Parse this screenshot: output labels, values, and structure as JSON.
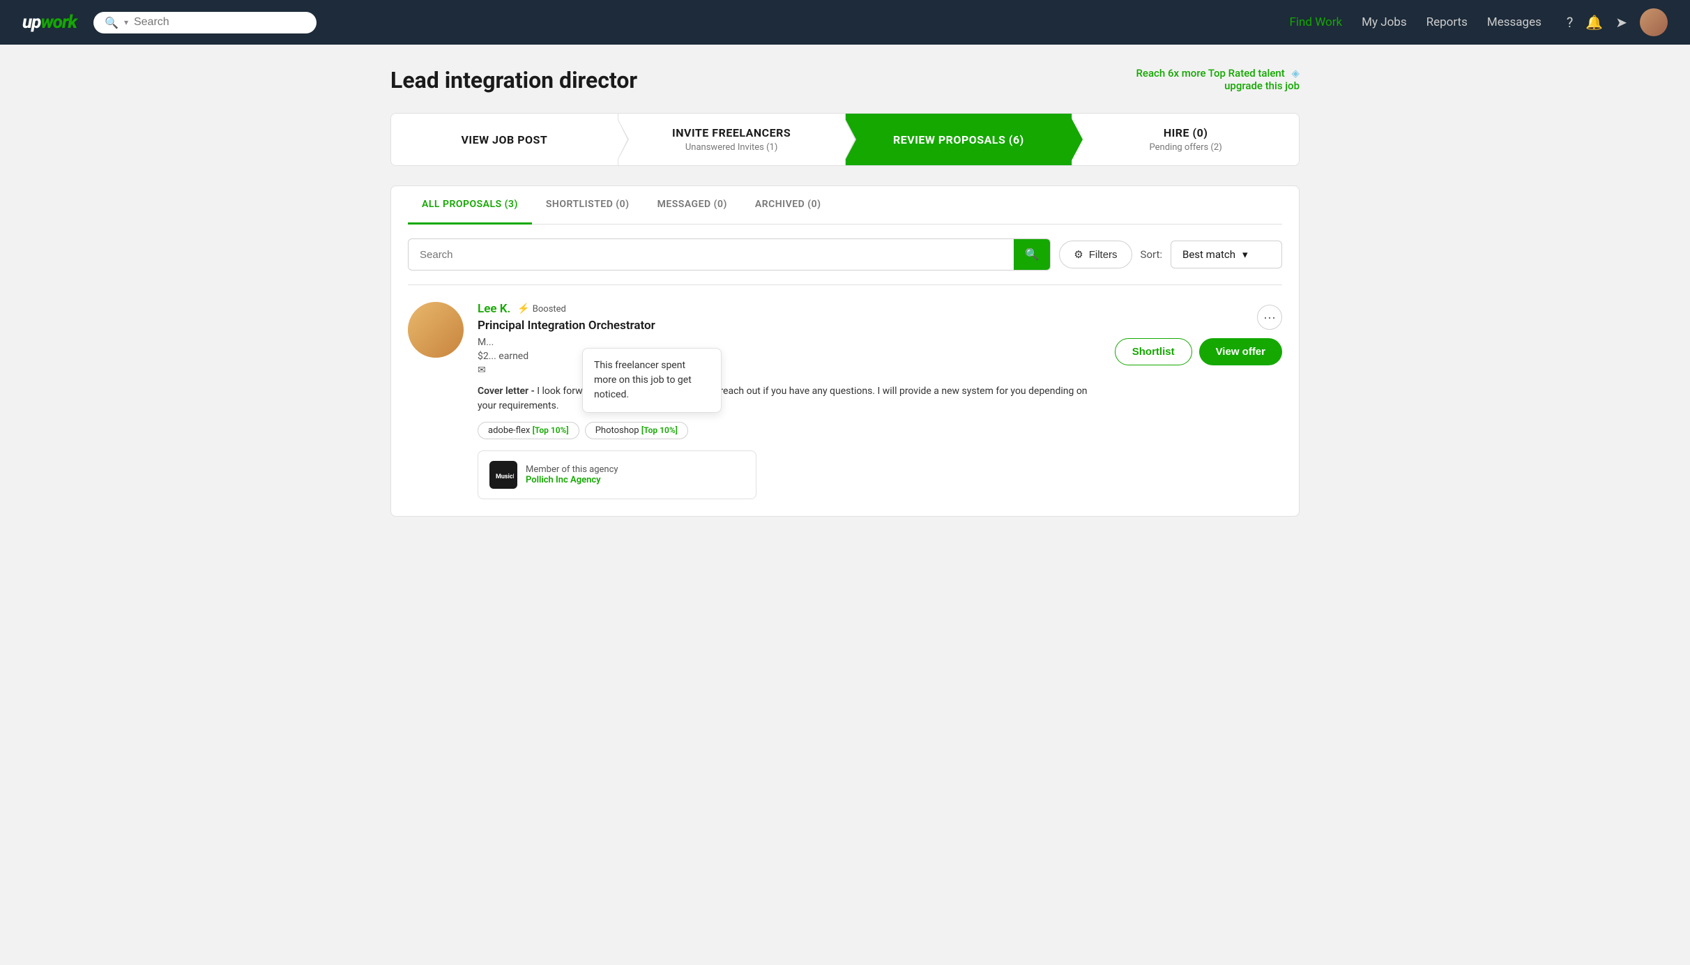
{
  "header": {
    "logo_text": "upwork",
    "search_placeholder": "Search",
    "nav": [
      {
        "id": "find-work",
        "label": "Find Work",
        "active": true
      },
      {
        "id": "my-jobs",
        "label": "My Jobs",
        "active": false
      },
      {
        "id": "reports",
        "label": "Reports",
        "active": false
      },
      {
        "id": "messages",
        "label": "Messages",
        "active": false
      }
    ],
    "help_icon": "?",
    "bell_icon": "🔔",
    "pointer_icon": "➤"
  },
  "page": {
    "title": "Lead integration director",
    "upgrade_text": "Reach 6x more Top Rated talent",
    "upgrade_subtext": "upgrade this job"
  },
  "workflow_steps": [
    {
      "id": "view-job-post",
      "title": "VIEW JOB POST",
      "subtitle": "",
      "active": false
    },
    {
      "id": "invite-freelancers",
      "title": "INVITE FREELANCERS",
      "subtitle": "Unanswered Invites (1)",
      "active": false
    },
    {
      "id": "review-proposals",
      "title": "REVIEW PROPOSALS (6)",
      "subtitle": "",
      "active": true
    },
    {
      "id": "hire",
      "title": "HIRE (0)",
      "subtitle": "Pending offers (2)",
      "active": false
    }
  ],
  "tabs": [
    {
      "id": "all-proposals",
      "label": "ALL PROPOSALS (3)",
      "active": true
    },
    {
      "id": "shortlisted",
      "label": "SHORTLISTED (0)",
      "active": false
    },
    {
      "id": "messaged",
      "label": "MESSAGED (0)",
      "active": false
    },
    {
      "id": "archived",
      "label": "ARCHIVED (0)",
      "active": false
    }
  ],
  "search": {
    "placeholder": "Search",
    "search_icon": "🔍",
    "filters_label": "Filters",
    "sort_label": "Sort:",
    "sort_option": "Best match"
  },
  "proposals": [
    {
      "id": "lee-k",
      "name": "Lee K.",
      "boosted": true,
      "boosted_label": "Boosted",
      "title": "Principal Integration Orchestrator",
      "meta_line1": "M...",
      "meta_line2": "$2... earned",
      "cover_label": "Cover letter -",
      "cover_text": "I look forward to working with you. Please reach out if you have any questions. I will provide a new system for you depending on your requirements.",
      "skills": [
        {
          "name": "adobe-flex",
          "badge": "Top 10%"
        },
        {
          "name": "Photoshop",
          "badge": "Top 10%"
        }
      ],
      "agency": {
        "name": "Pollich Inc Agency",
        "member_text": "Member of this agency"
      },
      "tooltip": "This freelancer spent more on this job to get noticed.",
      "shortlist_label": "Shortlist",
      "view_offer_label": "View offer"
    }
  ]
}
